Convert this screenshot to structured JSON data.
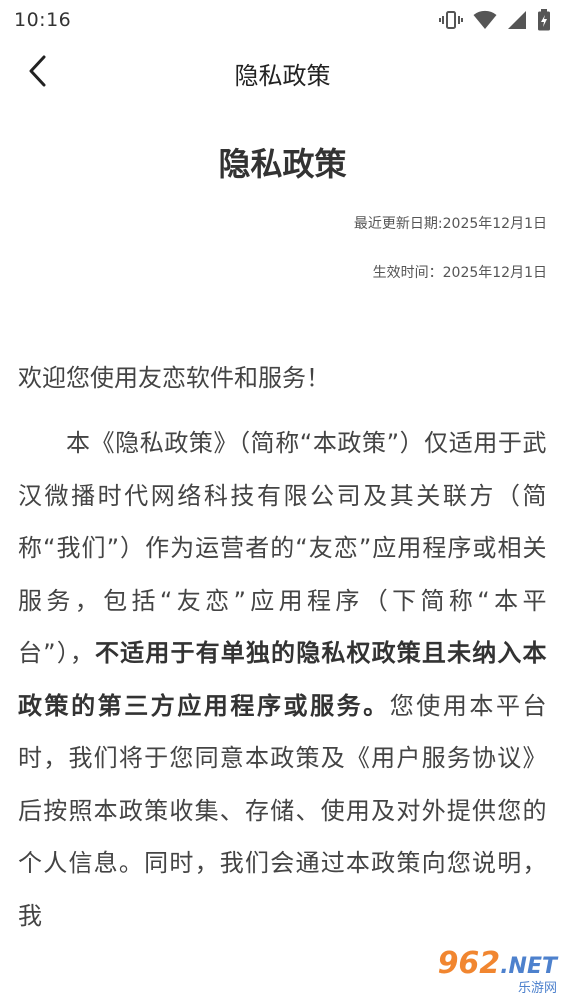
{
  "status_bar": {
    "time": "10:16"
  },
  "nav": {
    "title": "隐私政策"
  },
  "document": {
    "title": "隐私政策",
    "updated": "最近更新日期:2025年12月1日",
    "effective": "生效时间：2025年12月1日",
    "greeting": "欢迎您使用友恋软件和服务！",
    "para1_start": "本《隐私政策》（简称“本政策”）仅适用于武汉微播时代网络科技有限公司及其关联方（简称“我们”）作为运营者的“友恋”应用程序或相关服务，包括“友恋”应用程序（下简称“本平台”），",
    "para1_bold": "不适用于有单独的隐私权政策且未纳入本政策的第三方应用程序或服务。",
    "para1_end": "您使用本平台时，我们将于您同意本政策及《用户服务协议》后按照本政策收集、存储、使用及对外提供您的个人信息。同时，我们会通过本政策向您说明，我"
  },
  "watermark": {
    "number": "962",
    "domain": ".NET",
    "sub": "乐游网"
  },
  "colors": {
    "text": "#444444",
    "watermark_orange": "#f07a1a",
    "watermark_blue": "#3a74c8"
  }
}
